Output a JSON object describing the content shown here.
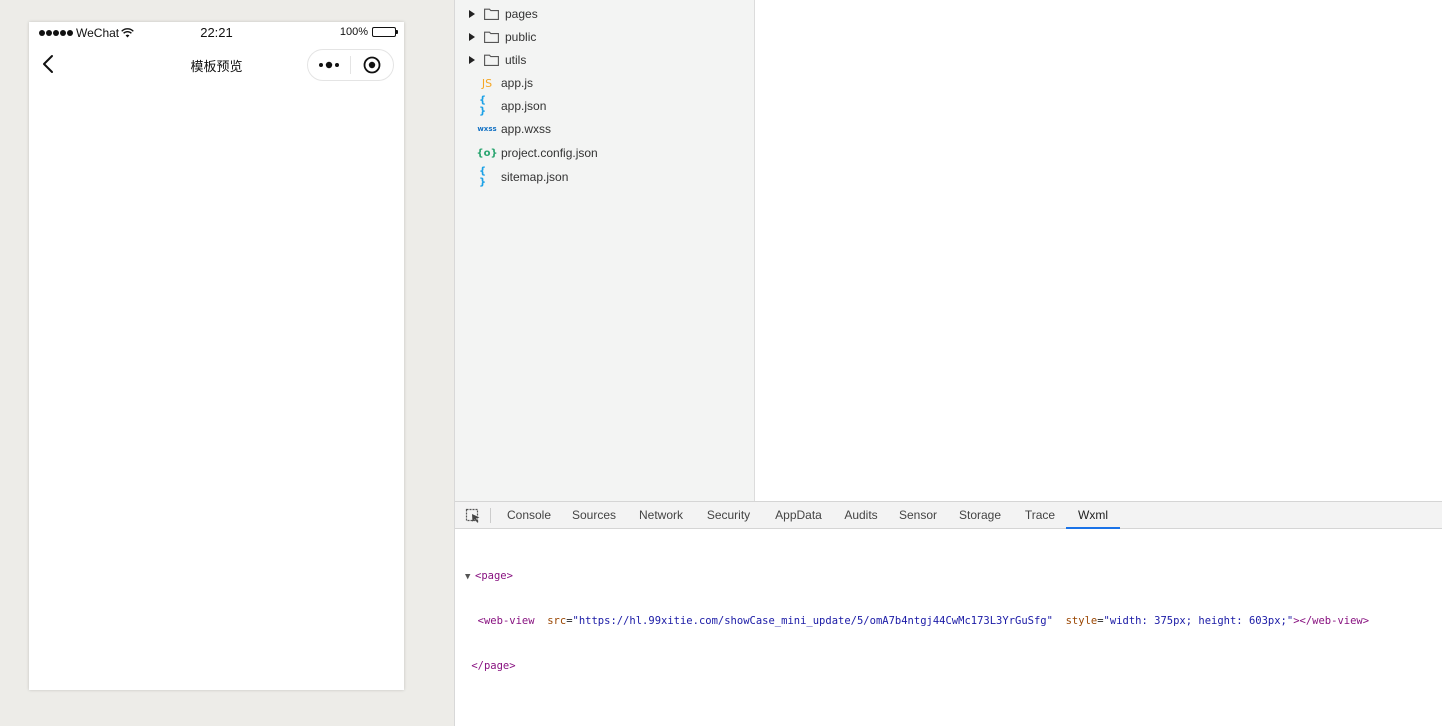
{
  "simulator": {
    "status_bar": {
      "carrier": "WeChat",
      "time": "22:21",
      "battery_percent": "100%"
    },
    "nav": {
      "title": "模板预览"
    }
  },
  "file_tree": {
    "items": [
      {
        "name": "pages",
        "type": "folder",
        "icon": "folder-icon"
      },
      {
        "name": "public",
        "type": "folder",
        "icon": "folder-icon"
      },
      {
        "name": "utils",
        "type": "folder",
        "icon": "folder-icon"
      },
      {
        "name": "app.js",
        "type": "file",
        "icon": "js-file-icon",
        "badge": "JS",
        "color": "#f5a623"
      },
      {
        "name": "app.json",
        "type": "file",
        "icon": "json-file-icon",
        "badge": "{ }",
        "color": "#1aa0e6"
      },
      {
        "name": "app.wxss",
        "type": "file",
        "icon": "wxss-file-icon",
        "badge": "wxss",
        "color": "#1673c4"
      },
      {
        "name": "project.config.json",
        "type": "file",
        "icon": "config-file-icon",
        "badge": "{o}",
        "color": "#2aa570"
      },
      {
        "name": "sitemap.json",
        "type": "file",
        "icon": "json-file-icon",
        "badge": "{ }",
        "color": "#1aa0e6"
      }
    ]
  },
  "devtools": {
    "tabs": [
      "Console",
      "Sources",
      "Network",
      "Security",
      "AppData",
      "Audits",
      "Sensor",
      "Storage",
      "Trace",
      "Wxml"
    ],
    "active_tab": "Wxml",
    "wxml": {
      "page_open": "<page>",
      "webview_open": "<web-view",
      "src_attr": "src",
      "src_value": "\"https://hl.99xitie.com/showCase_mini_update/5/omA7b4ntgj44CwMc173L3YrGuSfg\"",
      "style_attr": "style",
      "style_value": "\"width: 375px; height: 603px;\"",
      "webview_close": "></web-view>",
      "page_close": "</page>"
    }
  },
  "colors": {
    "active_tab_underline": "#1a73e8",
    "tag": "#881280",
    "attr": "#994500",
    "value": "#1a1aa6"
  }
}
